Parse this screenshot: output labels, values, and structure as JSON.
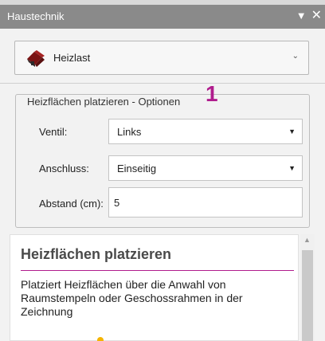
{
  "window": {
    "title": "Haustechnik",
    "pin_glyph": "▼",
    "close_glyph": "✕"
  },
  "module": {
    "label": "Heizlast",
    "chevron": "⌄"
  },
  "options": {
    "legend": "Heizflächen platzieren - Optionen",
    "marker": "1",
    "ventil": {
      "label": "Ventil:",
      "value": "Links"
    },
    "anschluss": {
      "label": "Anschluss:",
      "value": "Einseitig"
    },
    "abstand": {
      "label": "Abstand (cm):",
      "value": "5"
    }
  },
  "help": {
    "title": "Heizflächen platzieren",
    "text": "Platziert Heizflächen über die Anwahl von Raumstempeln oder Geschossrahmen in der Zeichnung"
  },
  "colors": {
    "accent": "#b01c8d",
    "titlebar": "#8a8a8a"
  },
  "icons": {
    "module": "heating-load-house-icon"
  }
}
